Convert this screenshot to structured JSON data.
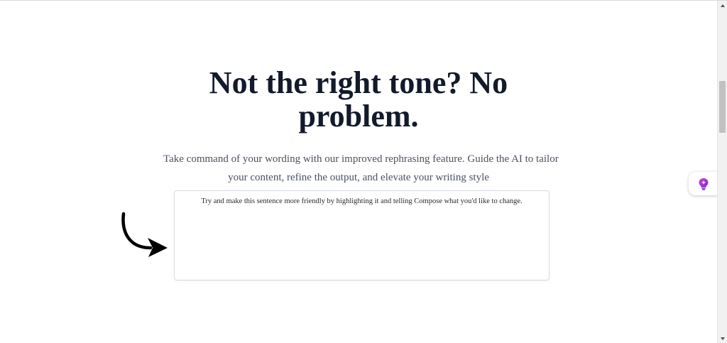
{
  "hero": {
    "headline_line1": "Not the right tone? No",
    "headline_line2": "problem.",
    "subtext_line1": "Take command of your wording with our improved rephrasing feature. Guide the AI to tailor",
    "subtext_line2": "your content, refine the output, and elevate your writing style"
  },
  "editor": {
    "text": "Try and make this sentence more friendly by highlighting it and telling Compose what you'd like to change."
  },
  "icons": {
    "arrow": "curved-arrow-icon",
    "floating_button": "lightbulb-icon"
  },
  "colors": {
    "headline": "#131a2b",
    "subtext": "#4a5160",
    "floating_icon_gradient_start": "#d63bd0",
    "floating_icon_gradient_end": "#7a2bd6"
  }
}
